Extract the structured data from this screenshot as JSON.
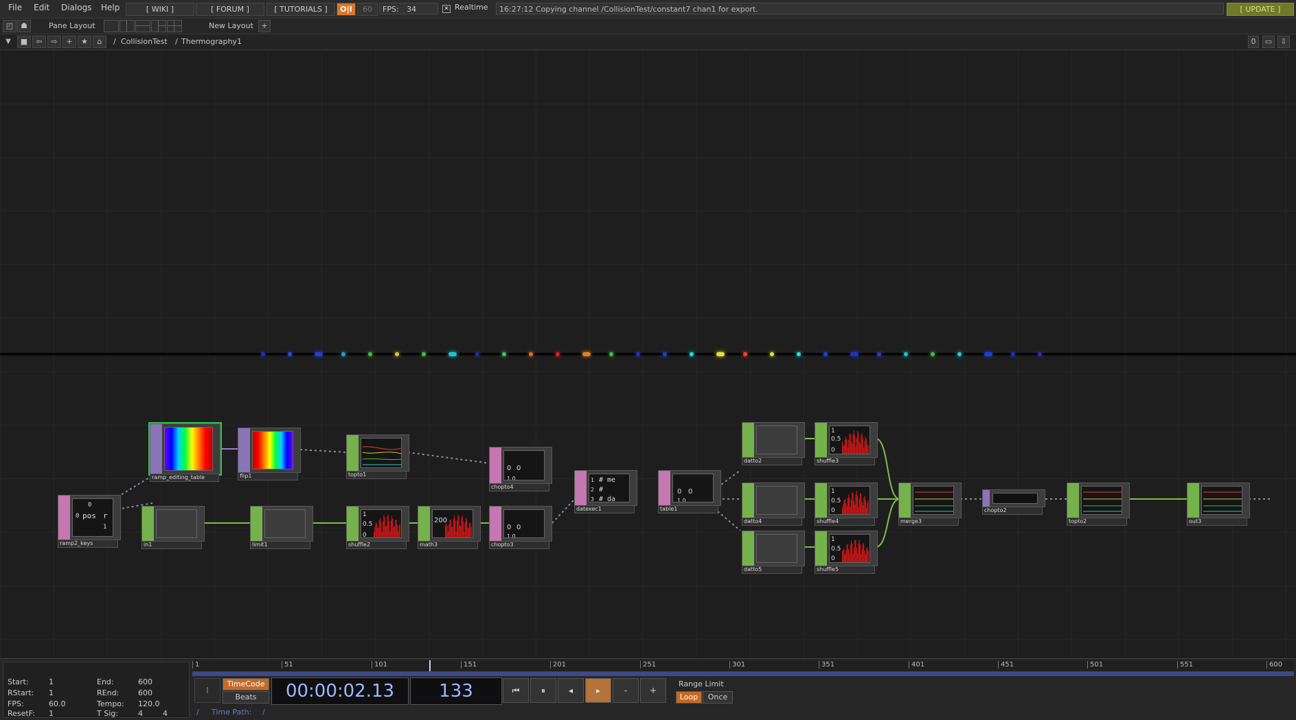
{
  "menu": {
    "file": "File",
    "edit": "Edit",
    "dialogs": "Dialogs",
    "help": "Help"
  },
  "links": {
    "wiki": "[ WIKI ]",
    "forum": "[ FORUM ]",
    "tutorials": "[ TUTORIALS ]"
  },
  "toolbar": {
    "oi": "O|I",
    "fps_cap": "60",
    "fps_label": "FPS:",
    "fps_value": "34",
    "realtime": "Realtime",
    "update": "[ UPDATE ]"
  },
  "status_message": "16:27:12 Copying channel /CollisionTest/constant7 chan1 for export.",
  "pane": {
    "pane_layout": "Pane Layout",
    "new_layout": "New Layout",
    "plus": "+"
  },
  "path": {
    "root": "/",
    "p1": "CollisionTest",
    "sep": "/",
    "p2": "Thermography1",
    "count": "0"
  },
  "nodes": {
    "ramp2_keys": "ramp2_keys",
    "ramp_editing_table": "ramp_editing_table",
    "flip1": "flip1",
    "topto1": "topto1",
    "chopto4": "chopto4",
    "in1": "in1",
    "limit1": "limit1",
    "shuffle2": "shuffle2",
    "math3": "math3",
    "chopto3": "chopto3",
    "datexec1": "datexec1",
    "table1": "table1",
    "datto2": "datto2",
    "datto4": "datto4",
    "datto5": "datto5",
    "shuffle3": "shuffle3",
    "shuffle4": "shuffle4",
    "shuffle5": "shuffle5",
    "merge3": "merge3",
    "chopto2": "chopto2",
    "topto2": "topto2",
    "out3": "out3"
  },
  "node_text": {
    "ramp_keys_0": "0",
    "ramp_keys_pos": "pos",
    "ramp_keys_r": "r",
    "ramp_keys_00": "0",
    "ramp_keys_1": "1",
    "chop_05": "0.5",
    "chop_1": "1",
    "chop_0": "0",
    "math_200": "200",
    "chopto_0a": "0",
    "chopto_0b": "0",
    "chopto_10": "1  0",
    "datexec_1": "1",
    "datexec_2": "2",
    "datexec_3": "3",
    "datexec_me": "# me",
    "datexec_h": "#",
    "datexec_da": "# da",
    "table_0a": "0",
    "table_0b": "0",
    "table_10": "1  0"
  },
  "timeline": {
    "ticks": [
      "1",
      "51",
      "101",
      "151",
      "201",
      "251",
      "301",
      "351",
      "401",
      "451",
      "501",
      "551",
      "600"
    ],
    "current_frame": "133",
    "timecode": "00:00:02.13"
  },
  "range_info": {
    "start_label": "Start:",
    "start": "1",
    "end_label": "End:",
    "end": "600",
    "rstart_label": "RStart:",
    "rstart": "1",
    "rend_label": "REnd:",
    "rend": "600",
    "fps_label": "FPS:",
    "fps": "60.0",
    "tempo_label": "Tempo:",
    "tempo": "120.0",
    "resetf_label": "ResetF:",
    "resetf": "1",
    "tsig_label": "T Sig:",
    "tsig_a": "4",
    "tsig_b": "4"
  },
  "transport": {
    "timecode_btn": "TimeCode",
    "beats_btn": "Beats",
    "range_limit": "Range Limit",
    "loop": "Loop",
    "once": "Once",
    "minus": "-",
    "plus": "+",
    "time_path_label": "Time Path:",
    "time_path": "/",
    "slash": "/"
  },
  "colors": {
    "accent": "#e08a3a",
    "chop": "#75b24c",
    "top": "#8a74b8",
    "dat": "#c477b0",
    "selected": "#2fc24a",
    "wire": "#7ec04b"
  }
}
